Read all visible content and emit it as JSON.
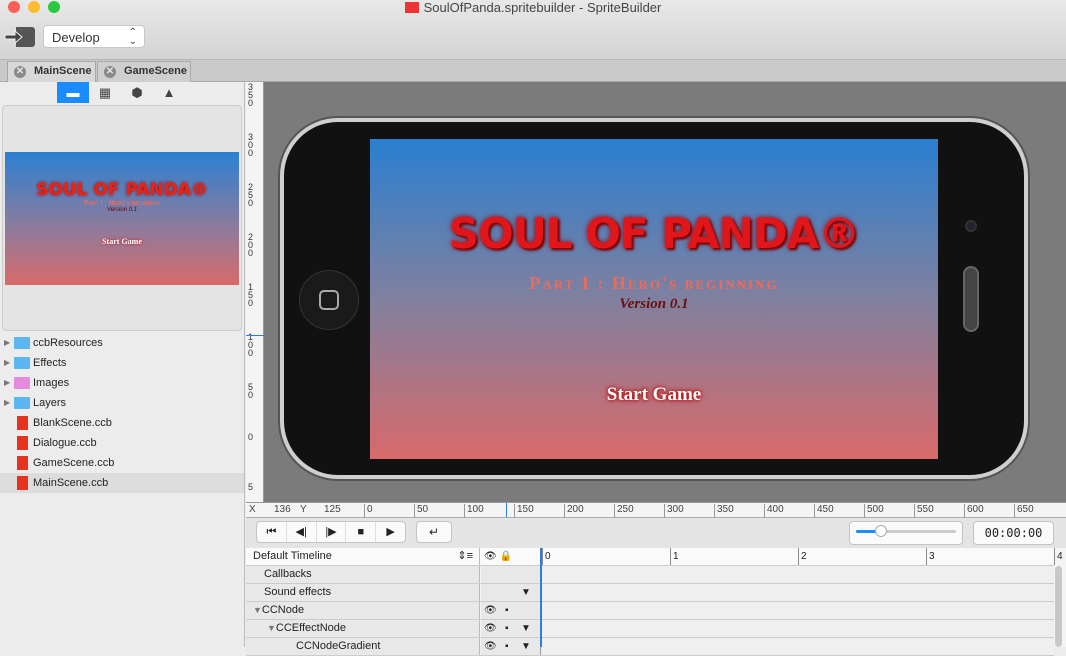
{
  "window": {
    "title": "SoulOfPanda.spritebuilder - SpriteBuilder"
  },
  "toolbar": {
    "publish_icon": "exit-arrow-icon",
    "target_select": "Develop"
  },
  "tabs": [
    {
      "label": "MainScene"
    },
    {
      "label": "GameScene"
    }
  ],
  "sidebar": {
    "buttons": [
      "folder-icon",
      "grid-icon",
      "cube-icon",
      "warning-icon"
    ],
    "preview": {
      "title": "SOUL OF PANDA®",
      "subtitle": "Part I : Hero's beginning",
      "version": "Version 0.1",
      "button": "Start Game"
    },
    "files": [
      {
        "label": "ccbResources",
        "type": "folder"
      },
      {
        "label": "Effects",
        "type": "folder"
      },
      {
        "label": "Images",
        "type": "image-folder"
      },
      {
        "label": "Layers",
        "type": "folder"
      },
      {
        "label": "BlankScene.ccb",
        "type": "ccb"
      },
      {
        "label": "Dialogue.ccb",
        "type": "ccb"
      },
      {
        "label": "GameScene.ccb",
        "type": "ccb"
      },
      {
        "label": "MainScene.ccb",
        "type": "ccb",
        "selected": true
      }
    ]
  },
  "scene": {
    "title": "SOUL OF PANDA®",
    "subtitle": "Part I : Hero's beginning",
    "version": "Version 0.1",
    "button": "Start Game",
    "gradient_top": "#2a7fd0",
    "gradient_bottom": "#d86a6a"
  },
  "rulers": {
    "vertical": [
      "350",
      "300",
      "250",
      "200",
      "150",
      "100",
      "50",
      "0",
      "5"
    ],
    "horizontal": [
      "0",
      "50",
      "100",
      "150",
      "200",
      "250",
      "300",
      "350",
      "400",
      "450",
      "500",
      "550",
      "600",
      "650"
    ],
    "x_label": "X",
    "x_value": "136",
    "y_label": "Y",
    "y_value": "125"
  },
  "playback": {
    "buttons": [
      "skip-to-start-icon",
      "step-back-icon",
      "step-forward-icon",
      "stop-icon",
      "play-icon"
    ],
    "loop": "loop-icon",
    "time": "00:00:00",
    "zoom_level": 0.25
  },
  "timeline": {
    "name": "Default Timeline",
    "ticks": [
      "0",
      "1",
      "2",
      "3",
      "4"
    ],
    "rows": [
      {
        "label": "Callbacks",
        "eye": false,
        "lock": false,
        "menu": false
      },
      {
        "label": "Sound effects",
        "eye": false,
        "lock": false,
        "menu": true
      },
      {
        "label": "CCNode",
        "eye": true,
        "lock": true,
        "menu": false,
        "indent": 0,
        "expanded": true
      },
      {
        "label": "CCEffectNode",
        "eye": true,
        "lock": true,
        "menu": true,
        "indent": 1,
        "expanded": true
      },
      {
        "label": "CCNodeGradient",
        "eye": true,
        "lock": true,
        "menu": true,
        "indent": 2
      }
    ]
  }
}
